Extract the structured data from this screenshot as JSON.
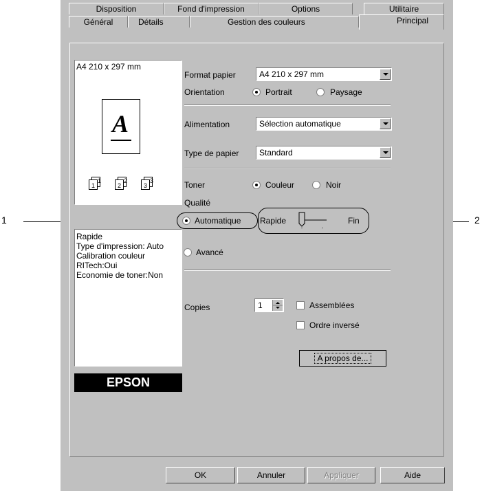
{
  "callouts": {
    "left": "1",
    "right": "2"
  },
  "tabs_back": [
    "Disposition",
    "Fond d'impression",
    "Options",
    "Utilitaire"
  ],
  "tabs_front": [
    "Général",
    "Détails",
    "Gestion des couleurs",
    "Principal"
  ],
  "preview": {
    "paper_label": "A4 210 x 297 mm",
    "letter": "A",
    "summary": [
      "Rapide",
      "Type d'impression: Auto",
      "Calibration couleur",
      "RITech:Oui",
      "Economie de toner:Non"
    ],
    "logo": "EPSON"
  },
  "form": {
    "format_label": "Format papier",
    "format_value": "A4 210 x 297 mm",
    "orientation_label": "Orientation",
    "portrait": "Portrait",
    "paysage": "Paysage",
    "alimentation_label": "Alimentation",
    "alimentation_value": "Sélection automatique",
    "type_label": "Type de papier",
    "type_value": "Standard",
    "toner_label": "Toner",
    "couleur": "Couleur",
    "noir": "Noir",
    "qualite_label": "Qualité",
    "automatique": "Automatique",
    "rapide": "Rapide",
    "fin": "Fin",
    "avance": "Avancé",
    "copies_label": "Copies",
    "copies_value": "1",
    "assemblees": "Assemblées",
    "ordre_inverse": "Ordre inversé",
    "apropos": "A propos de..."
  },
  "buttons": {
    "ok": "OK",
    "annuler": "Annuler",
    "appliquer": "Appliquer",
    "aide": "Aide"
  }
}
